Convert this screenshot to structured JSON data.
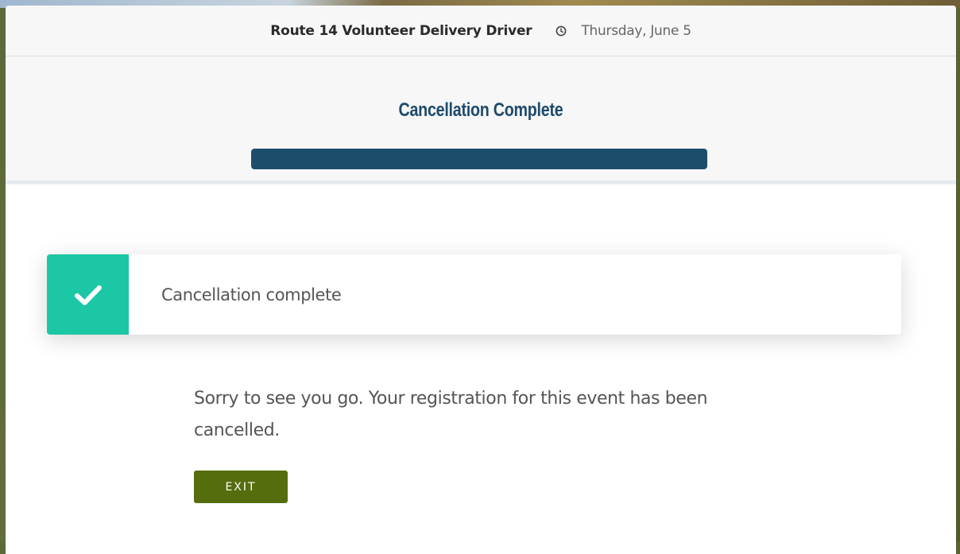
{
  "header": {
    "event_title": "Route 14 Volunteer Delivery Driver",
    "date": "Thursday, June 5",
    "clock_icon": "clock-icon"
  },
  "step": {
    "title": "Cancellation Complete",
    "progress_percent": 100
  },
  "alert": {
    "icon": "checkmark-icon",
    "text": "Cancellation complete",
    "color": "#1cc7a6"
  },
  "message": "Sorry to see you go. Your registration for this event has been cancelled.",
  "exit_button": {
    "label": "EXIT",
    "color": "#566d0e"
  },
  "colors": {
    "title_blue": "#1e4a6b",
    "progress_blue": "#1d4d6d"
  }
}
